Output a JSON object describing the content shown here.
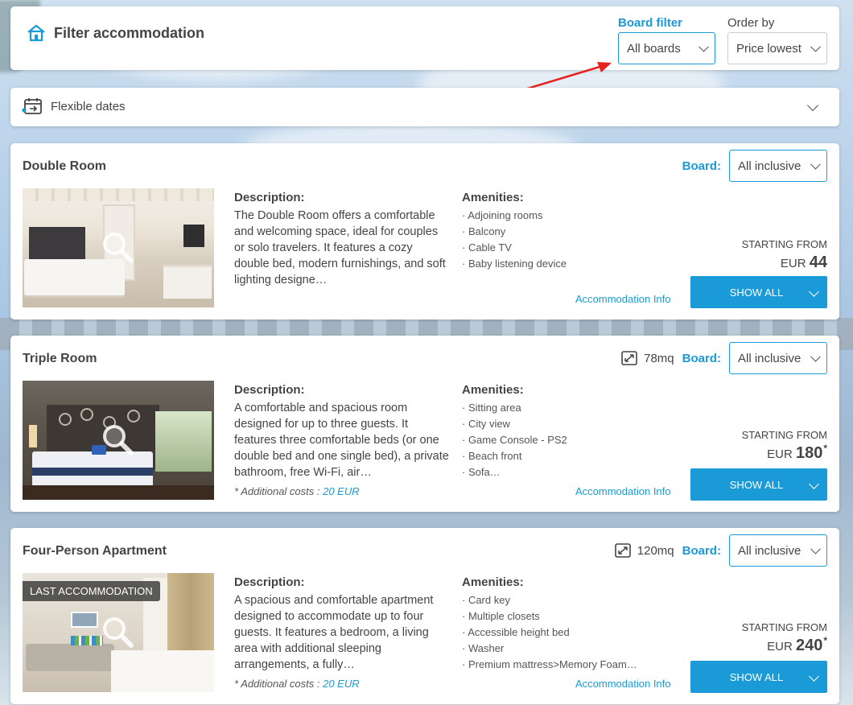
{
  "filter": {
    "title": "Filter accommodation",
    "board_filter_label": "Board filter",
    "board_filter_value": "All boards",
    "order_by_label": "Order by",
    "order_by_value": "Price lowest"
  },
  "flexible_dates": {
    "label": "Flexible dates"
  },
  "common": {
    "board_label": "Board:",
    "description_title": "Description:",
    "amenities_title": "Amenities:",
    "starting_from": "STARTING FROM",
    "currency": "EUR",
    "show_all": "SHOW ALL",
    "accommodation_info": "Accommodation Info",
    "additional_costs_label": "* Additional costs :"
  },
  "rooms": [
    {
      "name": "Double Room",
      "size": "",
      "board": "All inclusive",
      "description": "The Double Room offers a comfortable and welcoming space, ideal for couples or solo travelers. It features a cozy double bed, modern furnishings, and soft lighting designe…",
      "amenities": [
        "· Adjoining rooms",
        "· Balcony",
        "· Cable TV",
        "· Baby listening device"
      ],
      "price": "44",
      "price_mark": "",
      "additional_costs": "",
      "badge": ""
    },
    {
      "name": "Triple Room",
      "size": "78mq",
      "board": "All inclusive",
      "description": "A comfortable and spacious room designed for up to three guests. It features three comfortable beds (or one double bed and one single bed), a private bathroom, free Wi-Fi, air…",
      "amenities": [
        "· Sitting area",
        "· City view",
        "· Game Console - PS2",
        "· Beach front",
        "· Sofa…"
      ],
      "price": "180",
      "price_mark": "*",
      "additional_costs": "20 EUR",
      "badge": ""
    },
    {
      "name": "Four-Person Apartment",
      "size": "120mq",
      "board": "All inclusive",
      "description": "A spacious and comfortable apartment designed to accommodate up to four guests. It features a bedroom, a living area with additional sleeping arrangements, a fully…",
      "amenities": [
        "· Card key",
        "· Multiple closets",
        "· Accessible height bed",
        "· Washer",
        "· Premium mattress>Memory Foam…"
      ],
      "price": "240",
      "price_mark": "*",
      "additional_costs": "20 EUR",
      "badge": "LAST ACCOMMODATION"
    }
  ]
}
